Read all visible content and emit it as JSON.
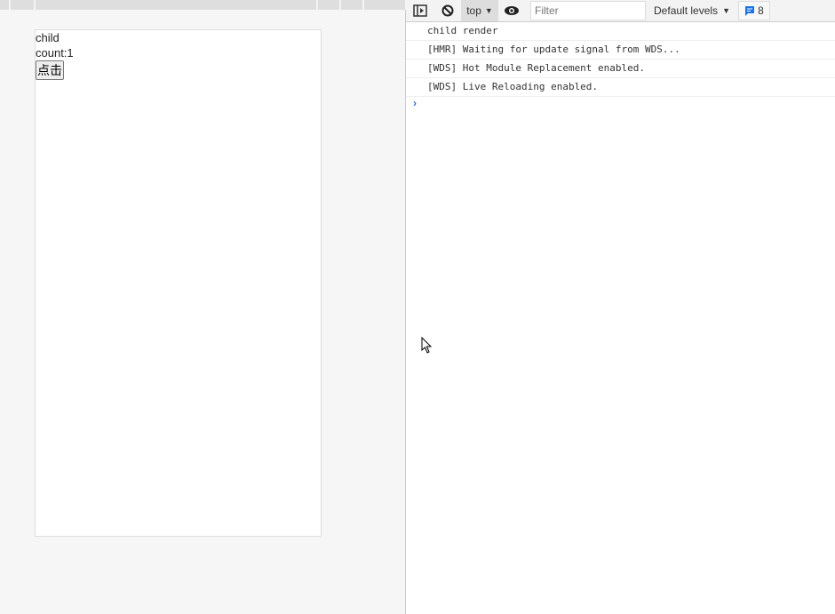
{
  "preview": {
    "label": "child",
    "count_text": "count:1",
    "button_label": "点击"
  },
  "console": {
    "context": "top",
    "filter_placeholder": "Filter",
    "levels": "Default levels",
    "message_count": "8",
    "messages": [
      "child render",
      "[HMR] Waiting for update signal from WDS...",
      "[WDS] Hot Module Replacement enabled.",
      "[WDS] Live Reloading enabled."
    ],
    "prompt": "›"
  }
}
